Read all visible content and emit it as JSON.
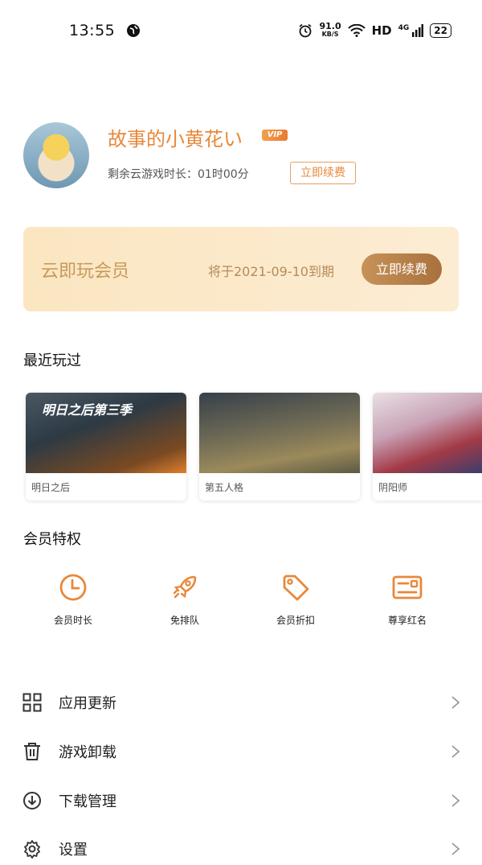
{
  "status_bar": {
    "time": "13:55",
    "speed_value": "91.0",
    "speed_unit": "KB/S",
    "hd": "HD",
    "network": "4G",
    "battery": "22"
  },
  "profile": {
    "username": "故事的小黄花い",
    "vip_badge": "VIP",
    "remaining_time": "剩余云游戏时长：01时00分",
    "renew_label": "立即续费"
  },
  "membership_card": {
    "title": "云即玩会员",
    "expire_text": "将于2021-09-10到期",
    "renew_label": "立即续费"
  },
  "recent": {
    "title": "最近玩过",
    "games": [
      {
        "name": "明日之后",
        "caption": "明日之后第三季"
      },
      {
        "name": "第五人格"
      },
      {
        "name": "阴阳师"
      }
    ]
  },
  "privileges": {
    "title": "会员特权",
    "items": [
      {
        "label": "会员时长",
        "icon": "clock-icon"
      },
      {
        "label": "免排队",
        "icon": "rocket-icon"
      },
      {
        "label": "会员折扣",
        "icon": "tag-icon"
      },
      {
        "label": "尊享红名",
        "icon": "id-card-icon"
      }
    ]
  },
  "menu": [
    {
      "label": "应用更新",
      "icon": "grid-icon"
    },
    {
      "label": "游戏卸载",
      "icon": "trash-icon"
    },
    {
      "label": "下载管理",
      "icon": "download-icon"
    },
    {
      "label": "设置",
      "icon": "gear-icon"
    }
  ],
  "colors": {
    "accent": "#e8883a",
    "card_bg": "#fbe6c1",
    "card_button": "#b57d45"
  }
}
